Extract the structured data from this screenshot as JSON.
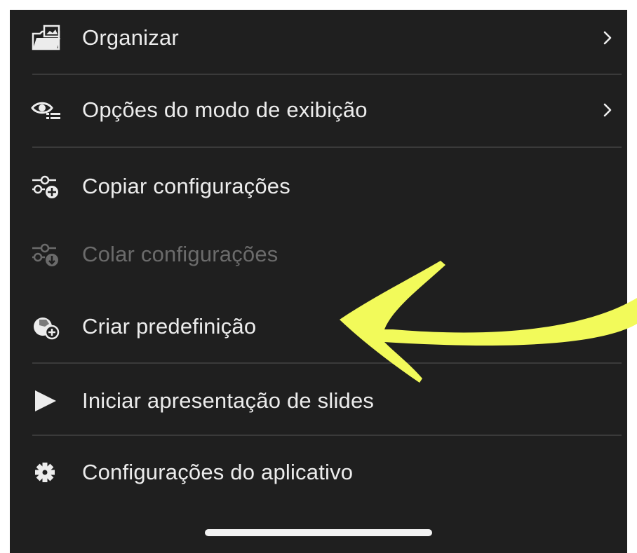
{
  "menu": {
    "items": [
      {
        "label": "Organizar",
        "icon": "folder-photo-icon",
        "has_submenu": true,
        "enabled": true
      },
      {
        "label": "Opções do modo de exibição",
        "icon": "view-options-icon",
        "has_submenu": true,
        "enabled": true
      },
      {
        "label": "Copiar configurações",
        "icon": "copy-settings-icon",
        "has_submenu": false,
        "enabled": true
      },
      {
        "label": "Colar configurações",
        "icon": "paste-settings-icon",
        "has_submenu": false,
        "enabled": false
      },
      {
        "label": "Criar predefinição",
        "icon": "create-preset-icon",
        "has_submenu": false,
        "enabled": true
      },
      {
        "label": "Iniciar apresentação de slides",
        "icon": "play-icon",
        "has_submenu": false,
        "enabled": true
      },
      {
        "label": "Configurações do aplicativo",
        "icon": "gear-icon",
        "has_submenu": false,
        "enabled": true
      }
    ]
  },
  "colors": {
    "menu_background": "#1f1f1f",
    "text": "#ececec",
    "disabled_text": "#6b6b6b",
    "divider": "#3a3a3a",
    "annotation_arrow": "#f2fa5a"
  }
}
